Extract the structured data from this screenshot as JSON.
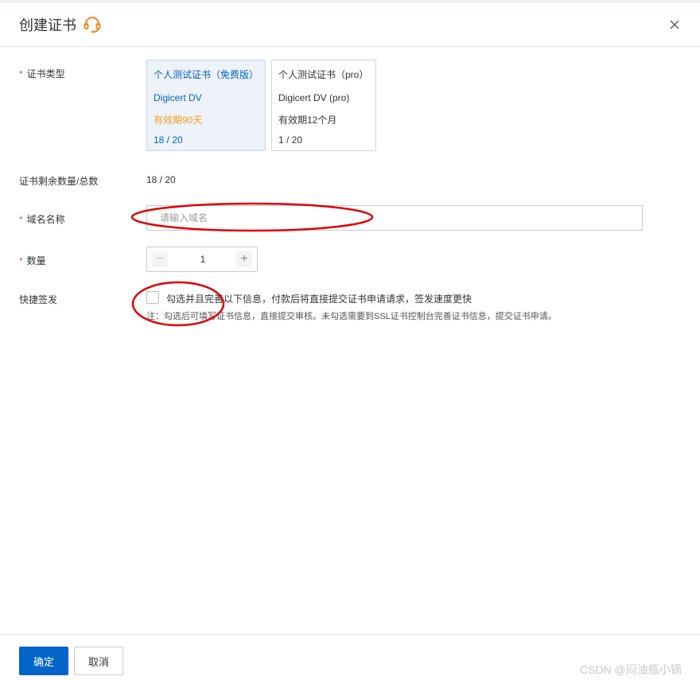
{
  "dialog": {
    "title": "创建证书",
    "support_icon": "headset-icon",
    "close_icon": "close-icon"
  },
  "form": {
    "cert_type": {
      "label": "证书类型",
      "options": [
        {
          "name": "个人测试证书（免费版）",
          "product": "Digicert DV",
          "validity": "有效期90天",
          "count": "18 / 20",
          "selected": true
        },
        {
          "name": "个人测试证书（pro）",
          "product": "Digicert DV (pro)",
          "validity": "有效期12个月",
          "count": "1 / 20",
          "selected": false
        }
      ]
    },
    "remaining": {
      "label": "证书剩余数量/总数",
      "value": "18 / 20"
    },
    "domain": {
      "label": "域名名称",
      "placeholder": "请输入域名",
      "value": ""
    },
    "quantity": {
      "label": "数量",
      "value": "1",
      "minus": "−",
      "plus": "+"
    },
    "quick_issue": {
      "label": "快捷签发",
      "checkbox_text": "勾选并且完善以下信息，付款后将直接提交证书申请请求，签发速度更快",
      "note": "注：勾选后可填写证书信息，直接提交审核。未勾选需要到SSL证书控制台完善证书信息，提交证书申请。",
      "checked": false
    },
    "required_mark": "*"
  },
  "footer": {
    "confirm_label": "确定",
    "cancel_label": "取消",
    "watermark": "CSDN @闷油瓶小锅"
  },
  "colors": {
    "primary": "#0064c8",
    "accent_orange": "#f0a020",
    "required": "#e34d59",
    "annotation_red": "#e00000"
  }
}
